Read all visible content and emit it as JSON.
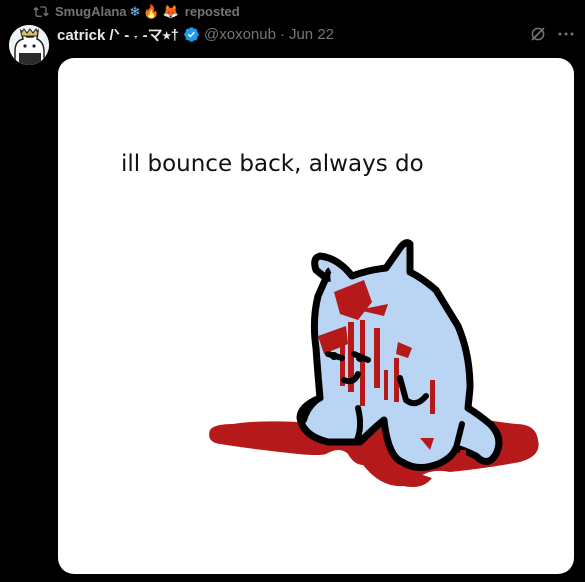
{
  "repost": {
    "user": "SmugAlana",
    "emojis": [
      "❄",
      "🔥",
      "🦊"
    ],
    "label": "reposted"
  },
  "post": {
    "display_name": "catrick /ᐠ - ˕ -マ⭑†",
    "handle": "@xoxonub",
    "separator": "·",
    "date": "Jun 22"
  },
  "media": {
    "caption": "ill bounce back, always do",
    "icon": "bloody-cat-drawing"
  },
  "colors": {
    "background": "#000000",
    "muted_text": "#71767b",
    "verified_blue": "#1d9bf0",
    "cat_fill": "#b8d4f5",
    "blood": "#bb1a1a"
  }
}
